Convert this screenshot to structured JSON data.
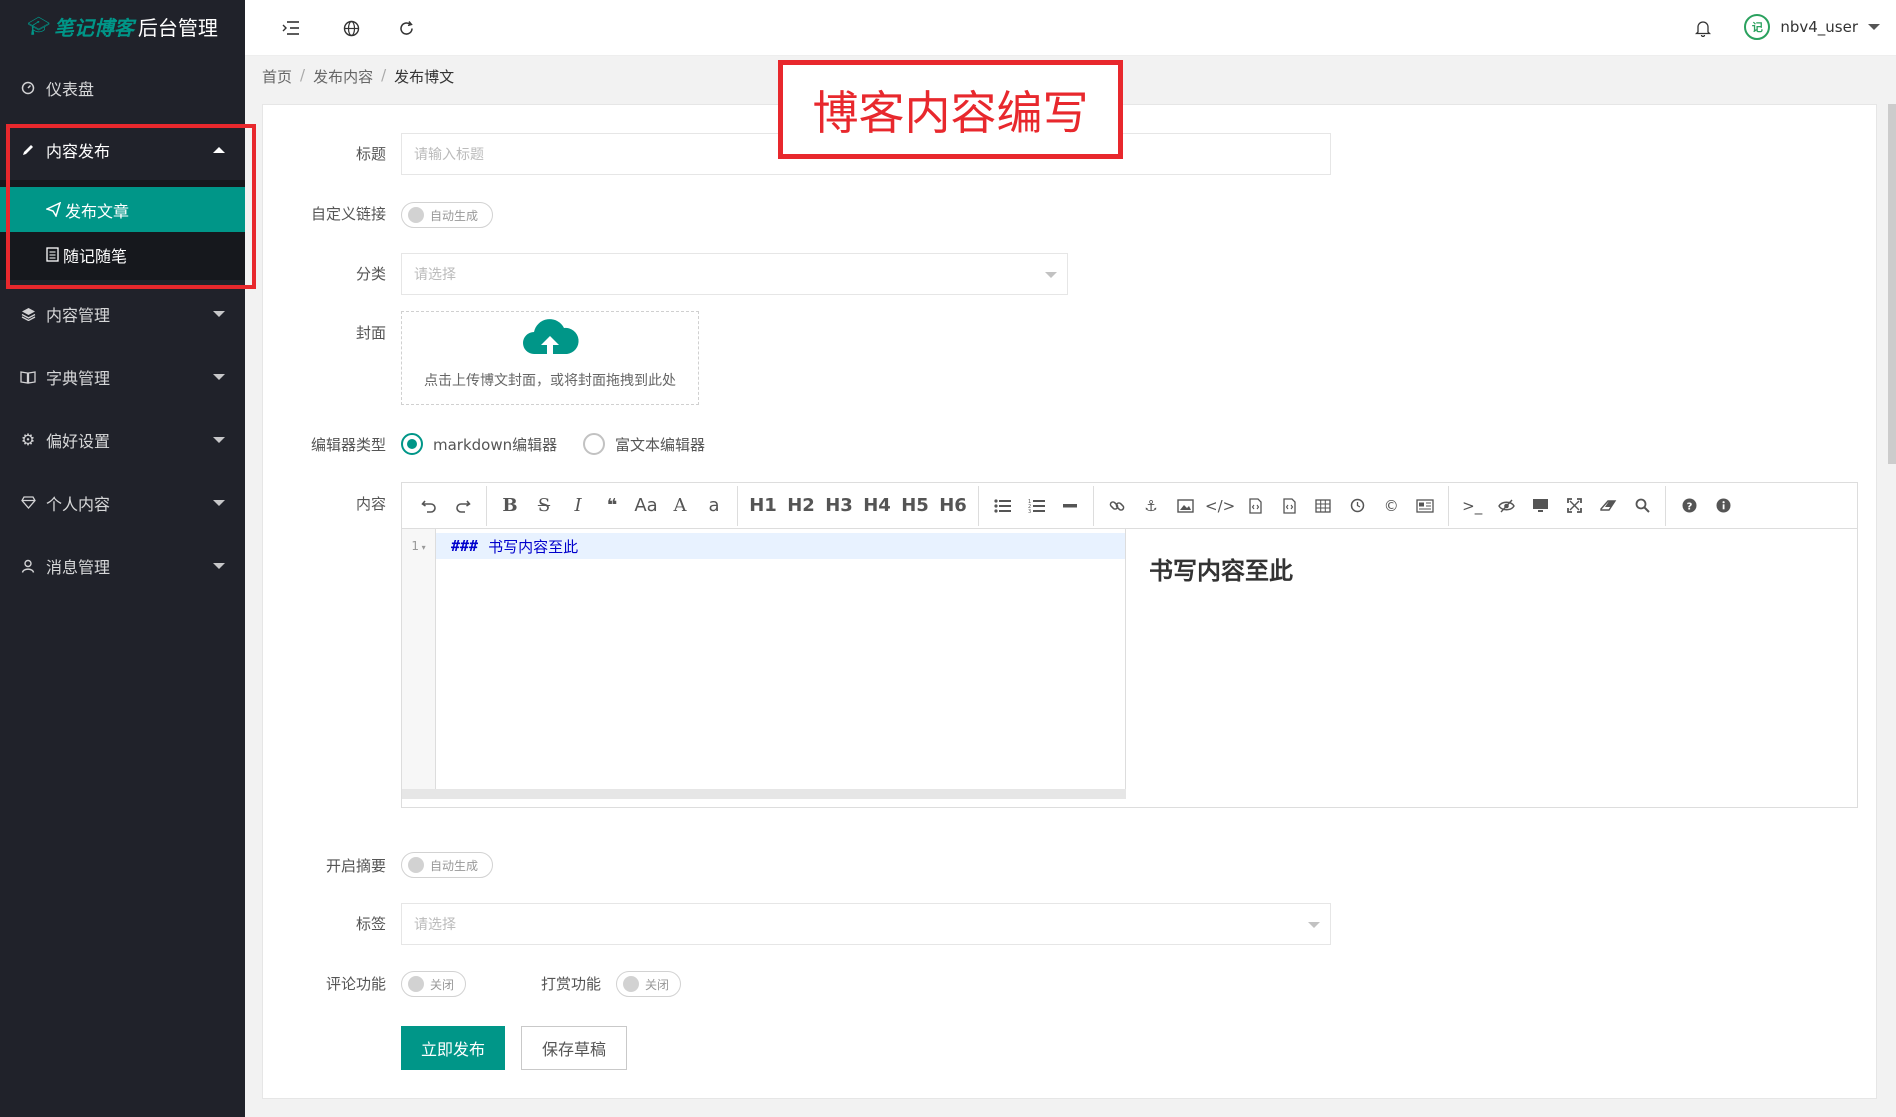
{
  "sidebar": {
    "logo": {
      "brand": "笔记博客",
      "suffix": "后台管理"
    },
    "items": [
      {
        "label": "仪表盘",
        "icon": "dashboard-icon"
      },
      {
        "label": "内容发布",
        "icon": "pencil-icon"
      },
      {
        "label": "内容管理",
        "icon": "layers-icon"
      },
      {
        "label": "字典管理",
        "icon": "book-icon"
      },
      {
        "label": "偏好设置",
        "icon": "gear-icon"
      },
      {
        "label": "个人内容",
        "icon": "diamond-icon"
      },
      {
        "label": "消息管理",
        "icon": "user-icon"
      }
    ],
    "submenu": [
      {
        "label": "发布文章",
        "icon": "paper-plane-icon"
      },
      {
        "label": "随记随笔",
        "icon": "document-icon"
      }
    ]
  },
  "header": {
    "username": "nbv4_user",
    "avatar_text": "记"
  },
  "breadcrumb": [
    "首页",
    "发布内容",
    "发布博文"
  ],
  "annotation": "博客内容编写",
  "form": {
    "title_label": "标题",
    "title_placeholder": "请输入标题",
    "link_label": "自定义链接",
    "link_switch": "自动生成",
    "category_label": "分类",
    "category_placeholder": "请选择",
    "cover_label": "封面",
    "cover_hint": "点击上传博文封面，或将封面拖拽到此处",
    "editor_type_label": "编辑器类型",
    "editor_type_options": [
      "markdown编辑器",
      "富文本编辑器"
    ],
    "editor_type_selected": "markdown编辑器",
    "content_label": "内容",
    "summary_label": "开启摘要",
    "summary_switch": "自动生成",
    "tags_label": "标签",
    "tags_placeholder": "请选择",
    "comment_label": "评论功能",
    "comment_switch": "关闭",
    "reward_label": "打赏功能",
    "reward_switch": "关闭",
    "publish_button": "立即发布",
    "draft_button": "保存草稿"
  },
  "editor": {
    "line_number": "1",
    "code_hash": "###",
    "code_text": "书写内容至此",
    "preview_heading": "书写内容至此",
    "toolbar_headings": [
      "H1",
      "H2",
      "H3",
      "H4",
      "H5",
      "H6"
    ],
    "toolbar_text": {
      "bold": "B",
      "strike": "S",
      "italic": "I",
      "quote": "❝",
      "case_upper": "Aa",
      "case_a": "A",
      "case_lower": "a"
    }
  },
  "colors": {
    "accent": "#009688",
    "sidebar": "#20222a",
    "annotation": "#e8282d"
  }
}
